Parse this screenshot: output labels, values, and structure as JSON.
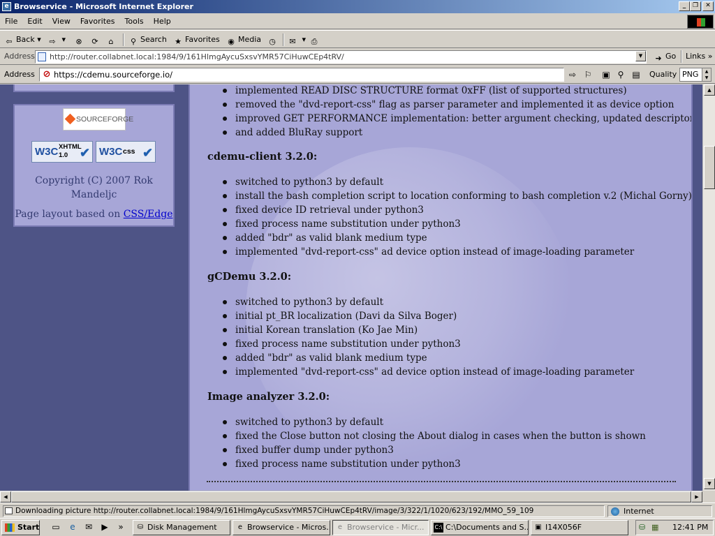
{
  "window": {
    "title": "Browservice - Microsoft Internet Explorer",
    "minimize": "_",
    "restore": "❐",
    "close": "✕"
  },
  "menu": [
    "File",
    "Edit",
    "View",
    "Favorites",
    "Tools",
    "Help"
  ],
  "toolbar": {
    "back": "Back",
    "search": "Search",
    "favorites": "Favorites",
    "media": "Media"
  },
  "outer_address": {
    "label": "Address",
    "url": "http://router.collabnet.local:1984/9/161HlmgAycuSxsvYMR57CiHuwCEp4tRV/",
    "go": "Go",
    "links": "Links"
  },
  "inner_address": {
    "label": "Address",
    "url": "https://cdemu.sourceforge.io/",
    "quality_label": "Quality",
    "quality_value": "PNG"
  },
  "sidebar": {
    "sourceforge": "SOURCEFORGE",
    "xhtml_w3c": "W3C",
    "xhtml_badge": "XHTML",
    "xhtml_ver": "1.0",
    "css_w3c": "W3C",
    "css_badge": "css",
    "copyright_1": "Copyright (C) 2007 Rok",
    "copyright_2": "Mandeljc",
    "layout_text": "Page layout based on ",
    "layout_link": "CSS/Edge"
  },
  "content": {
    "top_items": [
      "implemented READ DISC STRUCTURE format 0xFF (list of supported structures)",
      "removed the \"dvd-report-css\" flag as parser parameter and implemented it as device option",
      "improved GET PERFORMANCE implementation: better argument checking, updated descriptors,",
      "and added BluRay support"
    ],
    "sections": [
      {
        "heading": "cdemu-client 3.2.0:",
        "items": [
          "switched to python3 by default",
          "install the bash completion script to location conforming to bash completion v.2 (Michal Gorny)",
          "fixed device ID retrieval under python3",
          "fixed process name substitution under python3",
          "added \"bdr\" as valid blank medium type",
          "implemented \"dvd-report-css\" ad device option instead of image-loading parameter"
        ]
      },
      {
        "heading": "gCDemu 3.2.0:",
        "items": [
          "switched to python3 by default",
          "initial pt_BR localization (Davi da Silva Boger)",
          "initial Korean translation (Ko Jae Min)",
          "fixed process name substitution under python3",
          "added \"bdr\" as valid blank medium type",
          "implemented \"dvd-report-css\" ad device option instead of image-loading parameter"
        ]
      },
      {
        "heading": "Image analyzer 3.2.0:",
        "items": [
          "switched to python3 by default",
          "fixed the Close button not closing the About dialog in cases when the button is shown",
          "fixed buffer dump under python3",
          "fixed process name substitution under python3"
        ]
      }
    ]
  },
  "status": {
    "message": "Downloading picture http://router.collabnet.local:1984/9/161HlmgAycuSxsvYMR57CiHuwCEp4tRV/image/3/322/1/1020/623/192/MMO_59_109",
    "zone": "Internet"
  },
  "taskbar": {
    "start": "Start",
    "tasks": [
      "Disk Management",
      "Browservice - Micros...",
      "Browservice - Micr...",
      "C:\\Documents and S...",
      "I14X056F"
    ],
    "clock": "12:41 PM"
  },
  "colors": {
    "page_bg": "#4e5486",
    "content_bg": "#a7a6d7",
    "title_gradient_start": "#0a246a"
  }
}
